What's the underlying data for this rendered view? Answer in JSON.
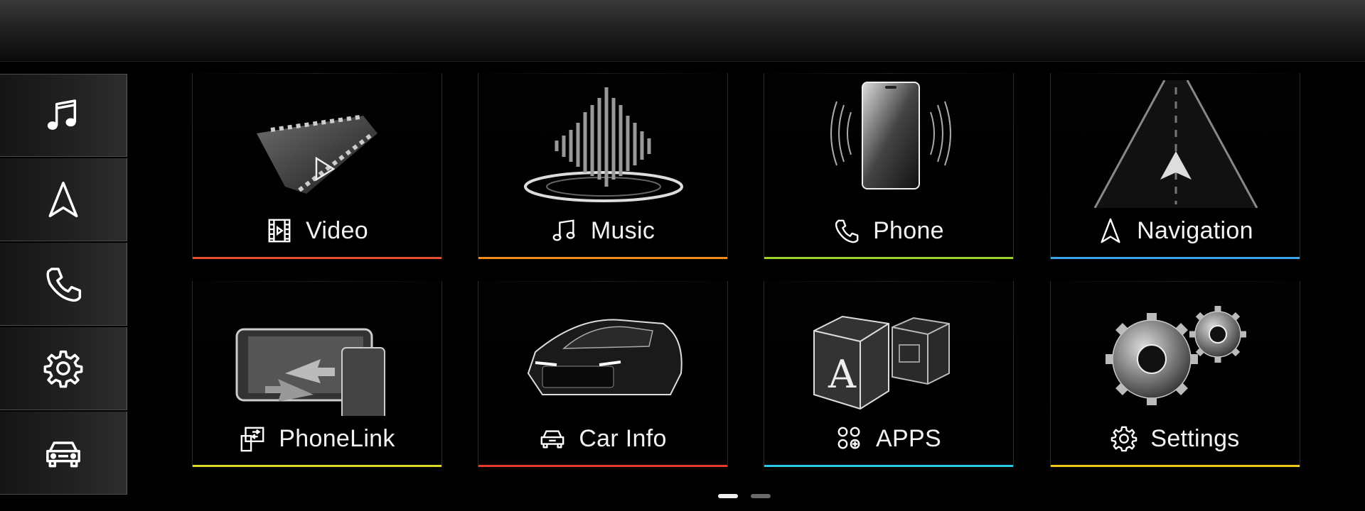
{
  "sidebar": {
    "items": [
      {
        "icon": "music-note-icon"
      },
      {
        "icon": "navigation-arrow-icon"
      },
      {
        "icon": "phone-icon"
      },
      {
        "icon": "gear-icon"
      },
      {
        "icon": "car-icon"
      }
    ]
  },
  "tiles": [
    {
      "label": "Video",
      "icon": "film-icon",
      "accent": "#e8502a"
    },
    {
      "label": "Music",
      "icon": "music-note-icon",
      "accent": "#f08a1c"
    },
    {
      "label": "Phone",
      "icon": "phone-icon",
      "accent": "#9bd32a"
    },
    {
      "label": "Navigation",
      "icon": "navigation-arrow-icon",
      "accent": "#3aa8e8"
    },
    {
      "label": "PhoneLink",
      "icon": "phonelink-icon",
      "accent": "#e0d82a"
    },
    {
      "label": "Car Info",
      "icon": "car-icon",
      "accent": "#e83a2a"
    },
    {
      "label": "APPS",
      "icon": "apps-grid-icon",
      "accent": "#2ac8e8"
    },
    {
      "label": "Settings",
      "icon": "gear-icon",
      "accent": "#f0c81c"
    }
  ],
  "pager": {
    "pages": 2,
    "active": 1
  },
  "colors": {
    "background": "#000000",
    "text": "#f2f2f2"
  }
}
